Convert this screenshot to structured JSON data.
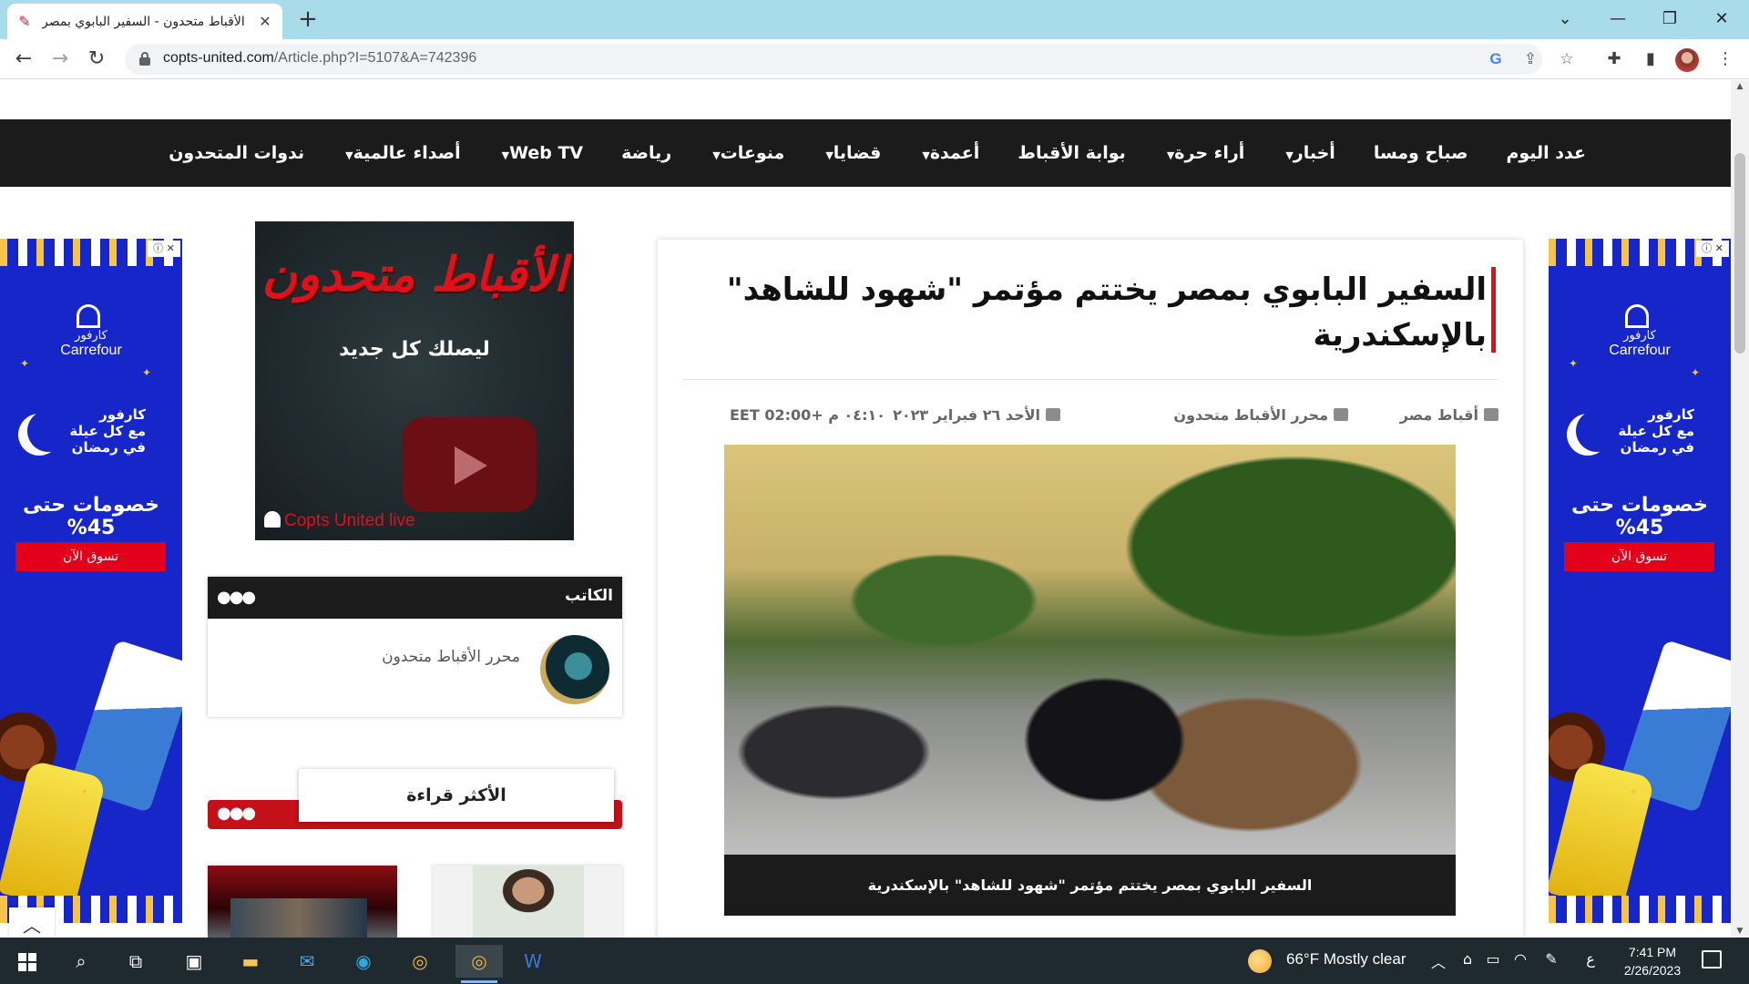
{
  "browser": {
    "tab_title": "الأقباط متحدون - السفير البابوي بمصر",
    "url_host": "copts-united.com",
    "url_path": "/Article.php?I=5107&A=742396"
  },
  "nav": {
    "items": [
      {
        "label": "عدد اليوم",
        "caret": ""
      },
      {
        "label": "صباح ومسا",
        "caret": ""
      },
      {
        "label": "أخبار",
        "caret": "▼"
      },
      {
        "label": "أراء حرة",
        "caret": "▼"
      },
      {
        "label": "بوابة الأقباط",
        "caret": ""
      },
      {
        "label": "أعمدة",
        "caret": "▼"
      },
      {
        "label": "قضايا",
        "caret": "▼"
      },
      {
        "label": "منوعات",
        "caret": "▼"
      },
      {
        "label": "رياضة",
        "caret": ""
      },
      {
        "label": "Web TV",
        "caret": "▼"
      },
      {
        "label": "أصداء عالمية",
        "caret": "▼"
      },
      {
        "label": "ندوات المتحدون",
        "caret": ""
      }
    ]
  },
  "side_ad": {
    "brand_ar": "كارفور",
    "brand_en": "Carrefour",
    "line1": "كارفور",
    "line2": "مع كل عيلة",
    "line3": "في رمضان",
    "sale": "خصومات حتى 45%",
    "cta": "تسوق الآن"
  },
  "video_widget": {
    "title": "الأقباط متحدون",
    "subtitle": "ليصلك كل جديد",
    "live_label": "Copts United live"
  },
  "author": {
    "heading": "الكاتب",
    "name": "محرر الأقباط متحدون"
  },
  "most_read": {
    "heading": "الأكثر قراءة"
  },
  "article": {
    "title": "السفير البابوي بمصر يختتم مؤتمر \"شهود للشاهد\" بالإسكندرية",
    "category": "أقباط مصر",
    "author": "محرر الأقباط متحدون",
    "date": "الأحد ٢٦ فبراير ٢٠٢٣",
    "time": "٠٤:١٠ م +02:00 EET",
    "caption": "السفير البابوي بمصر يختتم مؤتمر \"شهود للشاهد\" بالإسكندرية"
  },
  "taskbar": {
    "weather": "66°F  Mostly clear",
    "lang": "ع",
    "time": "7:41 PM",
    "date": "2/26/2023"
  }
}
